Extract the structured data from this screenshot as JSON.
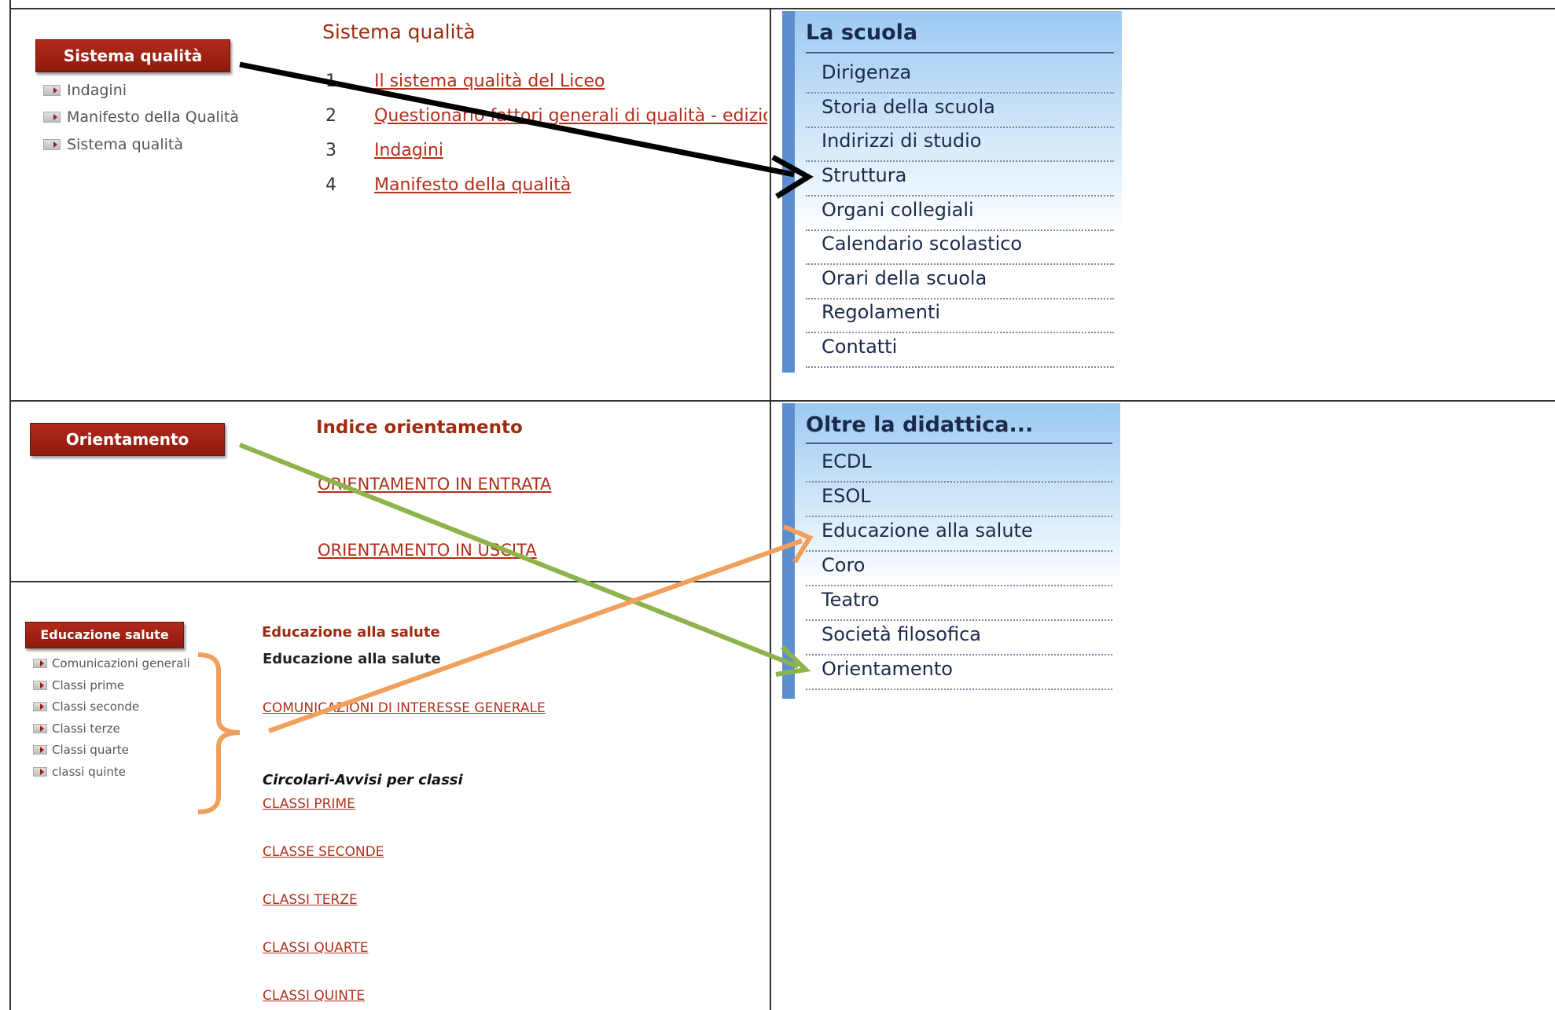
{
  "sistema": {
    "button": "Sistema qualità",
    "side_items": [
      "Indagini",
      "Manifesto della Qualità",
      "Sistema qualità"
    ],
    "title": "Sistema qualità",
    "list": [
      {
        "n": "1",
        "label": "Il sistema qualità del Liceo"
      },
      {
        "n": "2",
        "label": "Questionario fattori generali di qualità - edizione s"
      },
      {
        "n": "3",
        "label": "Indagini"
      },
      {
        "n": "4",
        "label": "Manifesto della qualità"
      }
    ]
  },
  "la_scuola": {
    "title": "La scuola",
    "items": [
      "Dirigenza",
      "Storia della scuola",
      "Indirizzi di studio",
      "Struttura",
      "Organi collegiali",
      "Calendario scolastico",
      "Orari della scuola",
      "Regolamenti",
      "Contatti"
    ]
  },
  "orientamento": {
    "button": "Orientamento",
    "title": "Indice orientamento",
    "links": [
      "ORIENTAMENTO IN ENTRATA",
      "ORIENTAMENTO IN USCITA"
    ]
  },
  "oltre": {
    "title": "Oltre la didattica...",
    "items": [
      "ECDL",
      "ESOL",
      "Educazione alla salute",
      "Coro",
      "Teatro",
      "Società filosofica",
      "Orientamento"
    ]
  },
  "salute": {
    "button": "Educazione salute",
    "side_items": [
      "Comunicazioni generali",
      "Classi prime",
      "Classi seconde",
      "Classi terze",
      "Classi quarte",
      "classi quinte"
    ],
    "title_red": "Educazione alla salute",
    "title_black": "Educazione alla salute",
    "link_general": "COMUNICAZIONI DI INTERESSE GENERALE",
    "circolari_label": "Circolari-Avvisi per classi",
    "class_links": [
      "CLASSI PRIME",
      "CLASSE SECONDE",
      "CLASSI TERZE",
      "CLASSI QUARTE",
      "CLASSI QUINTE"
    ]
  },
  "colors": {
    "arrow_black": "#000000",
    "arrow_green": "#8db34a",
    "arrow_orange": "#f0a05a",
    "accent_red": "#9e2a10",
    "menu_blue": "#5d8fd0"
  }
}
